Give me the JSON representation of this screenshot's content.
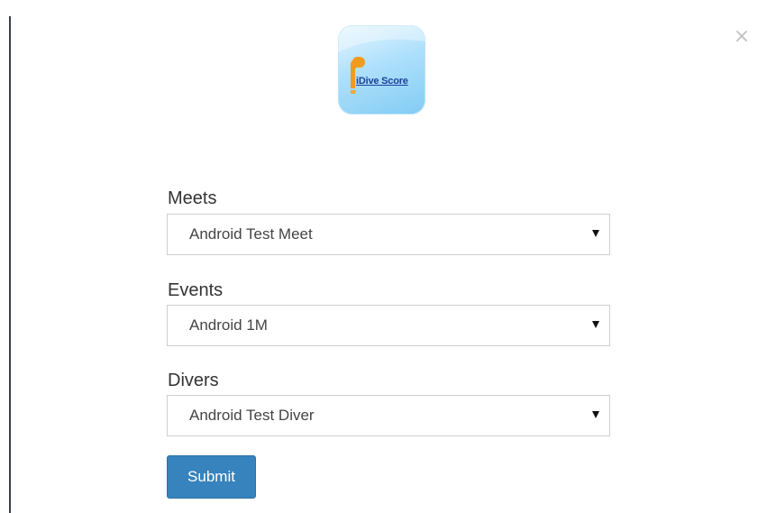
{
  "modal": {
    "close_glyph": "×",
    "logo_text": "iDive Score"
  },
  "form": {
    "meets": {
      "label": "Meets",
      "value": "Android Test Meet"
    },
    "events": {
      "label": "Events",
      "value": "Android 1M"
    },
    "divers": {
      "label": "Divers",
      "value": "Android Test Diver"
    },
    "submit_label": "Submit"
  },
  "colors": {
    "submit_bg": "#3683bd",
    "logo_text": "#1d3f9c",
    "logo_mark": "#f29a1d"
  },
  "icons": [
    "close-icon",
    "app-logo",
    "caret-down-icon"
  ]
}
